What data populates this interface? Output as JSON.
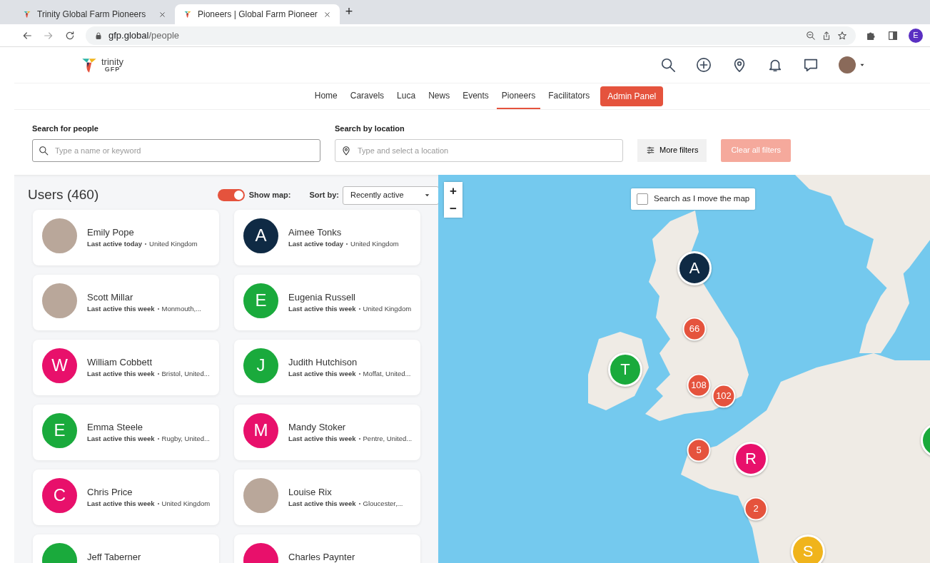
{
  "browser": {
    "tabs": [
      {
        "title": "Trinity Global Farm Pioneers",
        "selected": false
      },
      {
        "title": "Pioneers | Global Farm Pioneer",
        "selected": true
      }
    ],
    "new_tab": "+",
    "url": {
      "host": "gfp.global",
      "path": "/people"
    },
    "profile": "E"
  },
  "header": {
    "logo": {
      "word": "trinity",
      "sub": "GFP"
    },
    "nav": [
      {
        "label": "Home",
        "kind": "link",
        "selected": false
      },
      {
        "label": "Caravels",
        "kind": "link",
        "selected": false
      },
      {
        "label": "Luca",
        "kind": "link",
        "selected": false
      },
      {
        "label": "News",
        "kind": "link",
        "selected": false
      },
      {
        "label": "Events",
        "kind": "link",
        "selected": false
      },
      {
        "label": "Pioneers",
        "kind": "link",
        "selected": true
      },
      {
        "label": "Facilitators",
        "kind": "link",
        "selected": false
      },
      {
        "label": "Admin Panel",
        "kind": "button",
        "selected": false
      }
    ]
  },
  "filters": {
    "people": {
      "label": "Search for people",
      "placeholder": "Type a name or keyword"
    },
    "location": {
      "label": "Search by location",
      "placeholder": "Type and select a location"
    },
    "more": "More filters",
    "clear": {
      "label": "Clear all filters",
      "disabled": true
    }
  },
  "list": {
    "title": "Users (460)",
    "show_map": {
      "label": "Show map:",
      "on": true
    },
    "sort": {
      "label": "Sort by:",
      "value": "Recently active"
    },
    "users": [
      {
        "name": "Emily Pope",
        "activity": "Last active today",
        "location": "United Kingdom",
        "kind": "photo"
      },
      {
        "name": "Aimee Tonks",
        "activity": "Last active today",
        "location": "United Kingdom",
        "kind": "letter",
        "letter": "A",
        "color": "#0f2a44"
      },
      {
        "name": "Scott Millar",
        "activity": "Last active this week",
        "location": "Monmouth,...",
        "kind": "photo"
      },
      {
        "name": "Eugenia Russell",
        "activity": "Last active this week",
        "location": "United Kingdom",
        "kind": "letter",
        "letter": "E",
        "color": "#1aaa3c"
      },
      {
        "name": "William Cobbett",
        "activity": "Last active this week",
        "location": "Bristol, United...",
        "kind": "letter",
        "letter": "W",
        "color": "#e8106b"
      },
      {
        "name": "Judith Hutchison",
        "activity": "Last active this week",
        "location": "Moffat, United...",
        "kind": "letter",
        "letter": "J",
        "color": "#1aaa3c"
      },
      {
        "name": "Emma Steele",
        "activity": "Last active this week",
        "location": "Rugby, United...",
        "kind": "letter",
        "letter": "E",
        "color": "#1aaa3c"
      },
      {
        "name": "Mandy Stoker",
        "activity": "Last active this week",
        "location": "Pentre, United...",
        "kind": "letter",
        "letter": "M",
        "color": "#e8106b"
      },
      {
        "name": "Chris Price",
        "activity": "Last active this week",
        "location": "United Kingdom",
        "kind": "letter",
        "letter": "C",
        "color": "#e8106b"
      },
      {
        "name": "Louise Rix",
        "activity": "Last active this week",
        "location": "Gloucester,...",
        "kind": "photo"
      },
      {
        "name": "Jeff Taberner",
        "kind": "letter",
        "color": "#1aaa3c"
      },
      {
        "name": "Charles Paynter",
        "kind": "letter",
        "color": "#e8106b"
      }
    ]
  },
  "map": {
    "zoom_in": "+",
    "zoom_out": "−",
    "search_as_move": {
      "label": "Search as I move the map",
      "checked": false
    },
    "markers": [
      {
        "label": "A",
        "kind": "user",
        "color": "#0f2a44"
      },
      {
        "label": "66",
        "kind": "cluster",
        "color": "#e5533d"
      },
      {
        "label": "T",
        "kind": "user",
        "color": "#1aaa3c"
      },
      {
        "label": "108",
        "kind": "cluster",
        "color": "#e5533d"
      },
      {
        "label": "102",
        "kind": "cluster",
        "color": "#e5533d"
      },
      {
        "label": "5",
        "kind": "cluster",
        "color": "#e5533d"
      },
      {
        "label": "R",
        "kind": "user",
        "color": "#e8106b"
      },
      {
        "label": "2",
        "kind": "cluster",
        "color": "#e5533d"
      },
      {
        "label": "S",
        "kind": "user",
        "color": "#f0b41c"
      },
      {
        "kind": "user",
        "color": "#1aaa3c"
      }
    ]
  }
}
